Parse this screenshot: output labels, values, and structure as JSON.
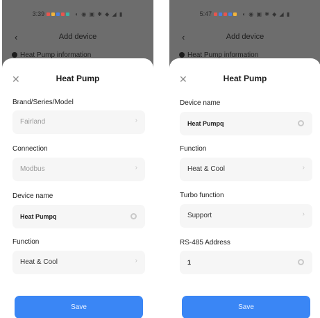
{
  "screens": [
    {
      "status_time": "3:39",
      "nav_title": "Add device",
      "bg_section": "Heat Pump information",
      "sheet_title": "Heat Pump",
      "fields": [
        {
          "label": "Brand/Series/Model",
          "value": "Fairland",
          "control": "chevron"
        },
        {
          "label": "Connection",
          "value": "Modbus",
          "control": "chevron"
        },
        {
          "label": "Device name",
          "value": "Heat Pumpq",
          "control": "clear"
        },
        {
          "label": "Function",
          "value": "Heat & Cool",
          "control": "chevron"
        }
      ],
      "save_label": "Save"
    },
    {
      "status_time": "5:47",
      "nav_title": "Add device",
      "bg_section": "Heat Pump information",
      "sheet_title": "Heat Pump",
      "fields": [
        {
          "label": "Device name",
          "value": "Heat Pumpq",
          "control": "clear"
        },
        {
          "label": "Function",
          "value": "Heat & Cool",
          "control": "chevron"
        },
        {
          "label": "Turbo function",
          "value": "Support",
          "control": "chevron"
        },
        {
          "label": "RS-485 Address",
          "value": "1",
          "control": "clear"
        }
      ],
      "save_label": "Save"
    }
  ],
  "icons": {
    "close": "close-icon",
    "back": "back-arrow-icon",
    "chevron": "chevron-right-icon",
    "clear": "clear-icon"
  },
  "colors": {
    "accent": "#3a86f5",
    "field_bg": "#f6f6f6",
    "overlay": "#6d6d6d",
    "notif_red": "#e8554e",
    "notif_yellow": "#f1b43c",
    "notif_blue": "#4a7fe0",
    "notif_teal": "#3bb3a5"
  }
}
